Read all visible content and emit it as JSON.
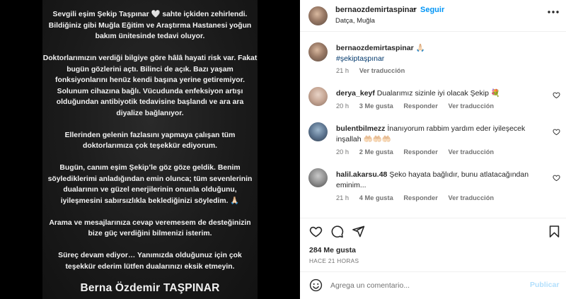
{
  "story": {
    "paragraphs": [
      "Sevgili eşim Şekip Taşpınar 🤍 sahte içkiden zehirlendi. Bildiğiniz gibi Muğla Eğitim ve Araştırma Hastanesi yoğun bakım ünitesinde tedavi oluyor.",
      "Doktorlarımızın verdiği bilgiye göre hâlâ hayati risk var. Fakat bugün gözlerini açtı. Bilinci de açık. Bazı yaşam fonksiyonlarını henüz kendi başına yerine getiremiyor. Solunum cihazına bağlı. Vücudunda enfeksiyon artışı olduğundan antibiyotik tedavisine başlandı ve ara ara diyalize bağlanıyor.",
      "Ellerinden gelenin fazlasını yapmaya çalışan tüm doktorlarımıza çok teşekkür ediyorum.",
      "Bugün, canım eşim Şekip’le göz göze geldik. Benim söylediklerimi anladığından emin olunca; tüm sevenlerinin dualarının ve güzel enerjilerinin onunla olduğunu, iyileşmesini sabırsızlıkla beklediğinizi söyledim. 🙏🏻",
      "Arama ve mesajlarınıza cevap veremesem de desteğinizin bize güç verdiğini bilmenizi isterim.",
      "Süreç devam ediyor… Yanımızda olduğunuz için çok teşekkür ederim lütfen dualarınızı eksik etmeyin."
    ],
    "signature": "Berna Özdemir TAŞPINAR"
  },
  "header": {
    "username": "bernaozdemirtaspinar",
    "separator": "•",
    "follow_label": "Seguir",
    "location": "Datça, Muğla",
    "more_icon": "more-horizontal-icon"
  },
  "caption": {
    "username": "bernaozdemirtaspinar",
    "emoji": "🙏🏻",
    "hashtag": "#şekiptaşpınar",
    "time": "21 h",
    "translate": "Ver traducción"
  },
  "comments": [
    {
      "username": "derya_keyf",
      "text": "Dualarımız sizinle iyi olacak Şekip 💐",
      "time": "20 h",
      "likes": "3 Me gusta",
      "reply": "Responder",
      "translate": "Ver traducción"
    },
    {
      "username": "bulentbilmezz",
      "text": "İnanıyorum rabbim yardım eder iyileşecek inşallah 🤲🏻🤲🏻🤲🏻",
      "time": "20 h",
      "likes": "2 Me gusta",
      "reply": "Responder",
      "translate": "Ver traducción"
    },
    {
      "username": "halil.akarsu.48",
      "text": "Şeko hayata bağlıdır, bunu atlatacağından eminim...",
      "time": "21 h",
      "likes": "4 Me gusta",
      "reply": "Responder",
      "translate": "Ver traducción"
    }
  ],
  "actions": {
    "like_icon": "heart-icon",
    "comment_icon": "comment-icon",
    "share_icon": "share-icon",
    "save_icon": "bookmark-icon"
  },
  "likes_count": "284 Me gusta",
  "time_ago": "HACE 21 HORAS",
  "add_comment": {
    "placeholder": "Agrega un comentario...",
    "publish_label": "Publicar",
    "emoji_icon": "emoji-icon"
  },
  "colors": {
    "accent": "#0095f6",
    "publish_disabled": "#b2dffc",
    "secondary_text": "#737373",
    "hashtag": "#00376b"
  }
}
